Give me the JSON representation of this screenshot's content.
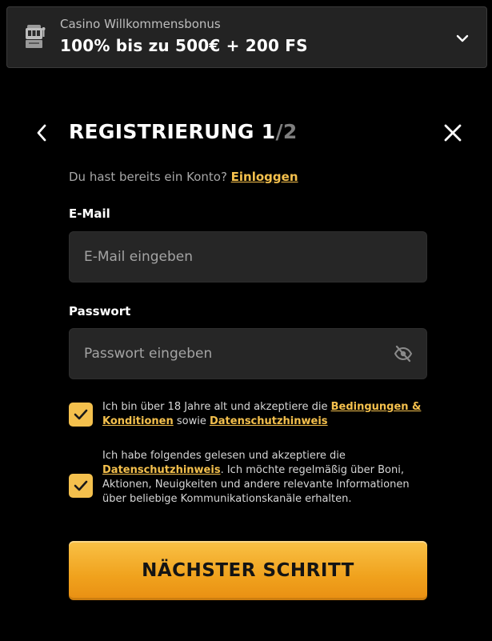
{
  "bonus_banner": {
    "subtitle": "Casino Willkommensbonus",
    "title": "100% bis zu 500€ + 200 FS",
    "icon": "slot-machine-icon",
    "toggle_icon": "chevron-down-icon"
  },
  "header": {
    "title_main": "REGISTRIERUNG 1",
    "title_total": "/2",
    "back_icon": "chevron-left-icon",
    "close_icon": "close-icon"
  },
  "login_prompt": {
    "text": "Du hast bereits ein Konto? ",
    "link": "Einloggen"
  },
  "form": {
    "email": {
      "label": "E-Mail",
      "placeholder": "E-Mail eingeben",
      "value": ""
    },
    "password": {
      "label": "Passwort",
      "placeholder": "Passwort eingeben",
      "value": "",
      "toggle_icon": "eye-off-icon"
    }
  },
  "consents": [
    {
      "checked": true,
      "text_before": "Ich bin über 18 Jahre alt und akzeptiere die ",
      "link1": "Bedingungen & Konditionen",
      "text_middle": " sowie ",
      "link2": "Datenschutzhinweis"
    },
    {
      "checked": true,
      "text_before": "Ich habe folgendes gelesen und akzeptiere die ",
      "link1": "Datenschutzhinweis",
      "text_after": ". Ich möchte regelmäßig über Boni, Aktionen, Neuigkeiten und andere relevante Informationen über beliebige Kommunikationskanäle erhalten."
    }
  ],
  "submit": {
    "label": "NÄCHSTER SCHRITT"
  },
  "colors": {
    "background": "#000000",
    "accent": "#f4c04d",
    "input_background": "#262626",
    "banner_background": "#232323",
    "muted_text": "#a7a7a7",
    "button_gradient_top": "#f9c146",
    "button_gradient_bottom": "#e98f12"
  }
}
